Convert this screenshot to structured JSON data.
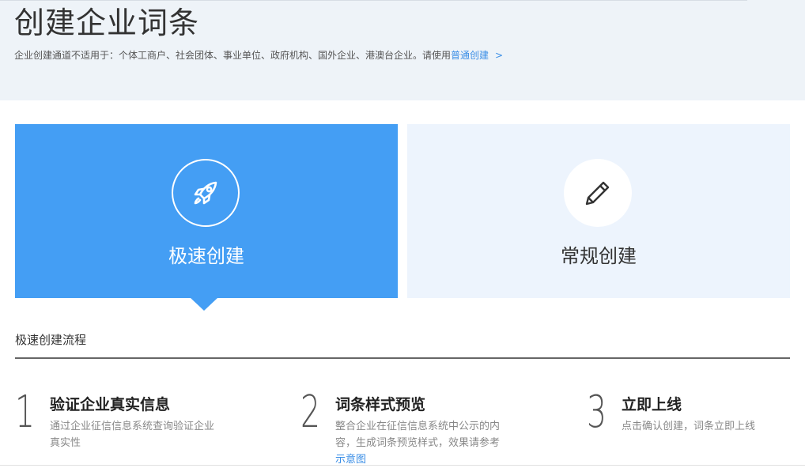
{
  "header": {
    "title": "创建企业词条",
    "note_text": "企业创建通道不适用于：个体工商户、社会团体、事业单位、政府机构、国外企业、港澳台企业。请使用",
    "note_link": "普通创建",
    "note_chevron": ">"
  },
  "options": {
    "fast": {
      "label": "极速创建",
      "icon": "rocket-icon",
      "selected": true
    },
    "normal": {
      "label": "常规创建",
      "icon": "pencil-icon",
      "selected": false
    }
  },
  "process": {
    "title": "极速创建流程",
    "steps": [
      {
        "num": "1",
        "title": "验证企业真实信息",
        "desc": "通过企业征信信息系统查询验证企业真实性"
      },
      {
        "num": "2",
        "title": "词条样式预览",
        "desc": "整合企业在征信信息系统中公示的内容，生成词条预览样式，效果请参考",
        "link": "示意图"
      },
      {
        "num": "3",
        "title": "立即上线",
        "desc": "点击确认创建，词条立即上线"
      }
    ]
  },
  "colors": {
    "accent": "#449ef4",
    "link": "#3a8ee6",
    "header_bg": "#eef3f8",
    "alt_bg": "#edf4fd"
  }
}
